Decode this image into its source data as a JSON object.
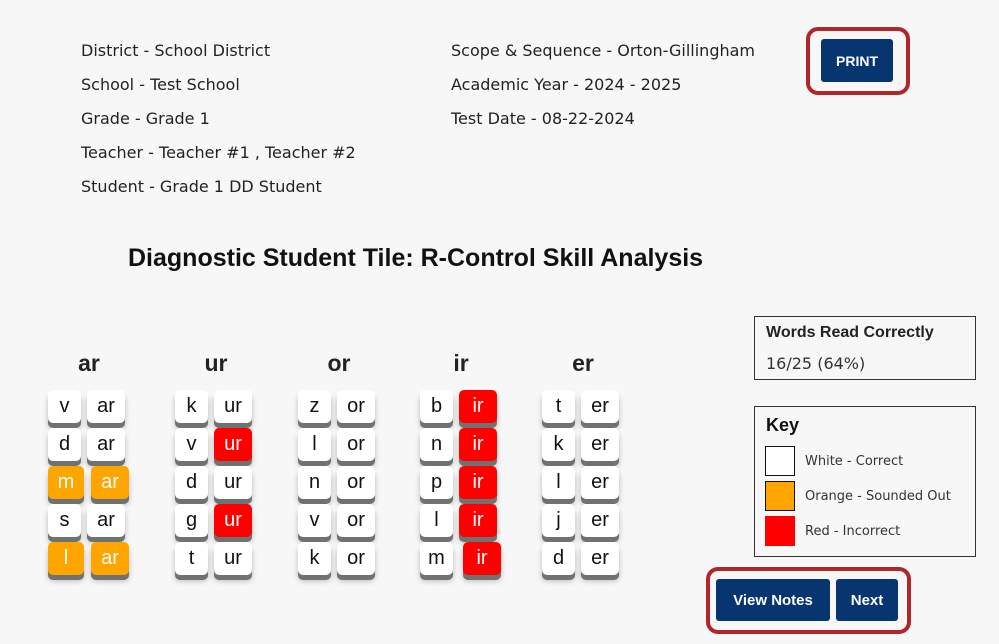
{
  "info_left": [
    "District - School District",
    "School - Test School",
    "Grade - Grade 1",
    "Teacher - Teacher #1 , Teacher #2",
    "Student - Grade 1 DD Student"
  ],
  "info_right": [
    "Scope & Sequence - Orton-Gillingham",
    "Academic Year - 2024 - 2025",
    "Test Date - 08-22-2024"
  ],
  "print_label": "PRINT",
  "title": "Diagnostic Student Tile: R-Control Skill Analysis",
  "colors": {
    "correct": "#ffffff",
    "sounded_out": "#ffa500",
    "incorrect": "#ff0000",
    "button": "#063570",
    "highlight": "#b0262b"
  },
  "columns": [
    {
      "header": "ar",
      "rows": [
        {
          "onset": "v",
          "onset_status": "correct",
          "rime": "ar",
          "rime_status": "correct"
        },
        {
          "onset": "d",
          "onset_status": "correct",
          "rime": "ar",
          "rime_status": "correct"
        },
        {
          "onset": "m",
          "onset_status": "sounded_out",
          "rime": "ar",
          "rime_status": "sounded_out"
        },
        {
          "onset": "s",
          "onset_status": "correct",
          "rime": "ar",
          "rime_status": "correct"
        },
        {
          "onset": "l",
          "onset_status": "sounded_out",
          "rime": "ar",
          "rime_status": "sounded_out"
        }
      ]
    },
    {
      "header": "ur",
      "rows": [
        {
          "onset": "k",
          "onset_status": "correct",
          "rime": "ur",
          "rime_status": "correct"
        },
        {
          "onset": "v",
          "onset_status": "correct",
          "rime": "ur",
          "rime_status": "incorrect"
        },
        {
          "onset": "d",
          "onset_status": "correct",
          "rime": "ur",
          "rime_status": "correct"
        },
        {
          "onset": "g",
          "onset_status": "correct",
          "rime": "ur",
          "rime_status": "incorrect"
        },
        {
          "onset": "t",
          "onset_status": "correct",
          "rime": "ur",
          "rime_status": "correct"
        }
      ]
    },
    {
      "header": "or",
      "rows": [
        {
          "onset": "z",
          "onset_status": "correct",
          "rime": "or",
          "rime_status": "correct"
        },
        {
          "onset": "l",
          "onset_status": "correct",
          "rime": "or",
          "rime_status": "correct"
        },
        {
          "onset": "n",
          "onset_status": "correct",
          "rime": "or",
          "rime_status": "correct"
        },
        {
          "onset": "v",
          "onset_status": "correct",
          "rime": "or",
          "rime_status": "correct"
        },
        {
          "onset": "k",
          "onset_status": "correct",
          "rime": "or",
          "rime_status": "correct"
        }
      ]
    },
    {
      "header": "ir",
      "rows": [
        {
          "onset": "b",
          "onset_status": "correct",
          "rime": "ir",
          "rime_status": "incorrect"
        },
        {
          "onset": "n",
          "onset_status": "correct",
          "rime": "ir",
          "rime_status": "incorrect"
        },
        {
          "onset": "p",
          "onset_status": "correct",
          "rime": "ir",
          "rime_status": "incorrect"
        },
        {
          "onset": "l",
          "onset_status": "correct",
          "rime": "ir",
          "rime_status": "incorrect"
        },
        {
          "onset": "m",
          "onset_status": "correct",
          "rime": "ir",
          "rime_status": "incorrect"
        }
      ]
    },
    {
      "header": "er",
      "rows": [
        {
          "onset": "t",
          "onset_status": "correct",
          "rime": "er",
          "rime_status": "correct"
        },
        {
          "onset": "k",
          "onset_status": "correct",
          "rime": "er",
          "rime_status": "correct"
        },
        {
          "onset": "l",
          "onset_status": "correct",
          "rime": "er",
          "rime_status": "correct"
        },
        {
          "onset": "j",
          "onset_status": "correct",
          "rime": "er",
          "rime_status": "correct"
        },
        {
          "onset": "d",
          "onset_status": "correct",
          "rime": "er",
          "rime_status": "correct"
        }
      ]
    }
  ],
  "score": {
    "heading": "Words Read Correctly",
    "value": "16/25 (64%)"
  },
  "key": {
    "heading": "Key",
    "items": [
      {
        "label": "White - Correct",
        "color": "#ffffff"
      },
      {
        "label": "Orange - Sounded Out",
        "color": "#ffa500"
      },
      {
        "label": "Red - Incorrect",
        "color": "#ff0000"
      }
    ]
  },
  "buttons": {
    "view_notes": "View Notes",
    "next": "Next"
  }
}
